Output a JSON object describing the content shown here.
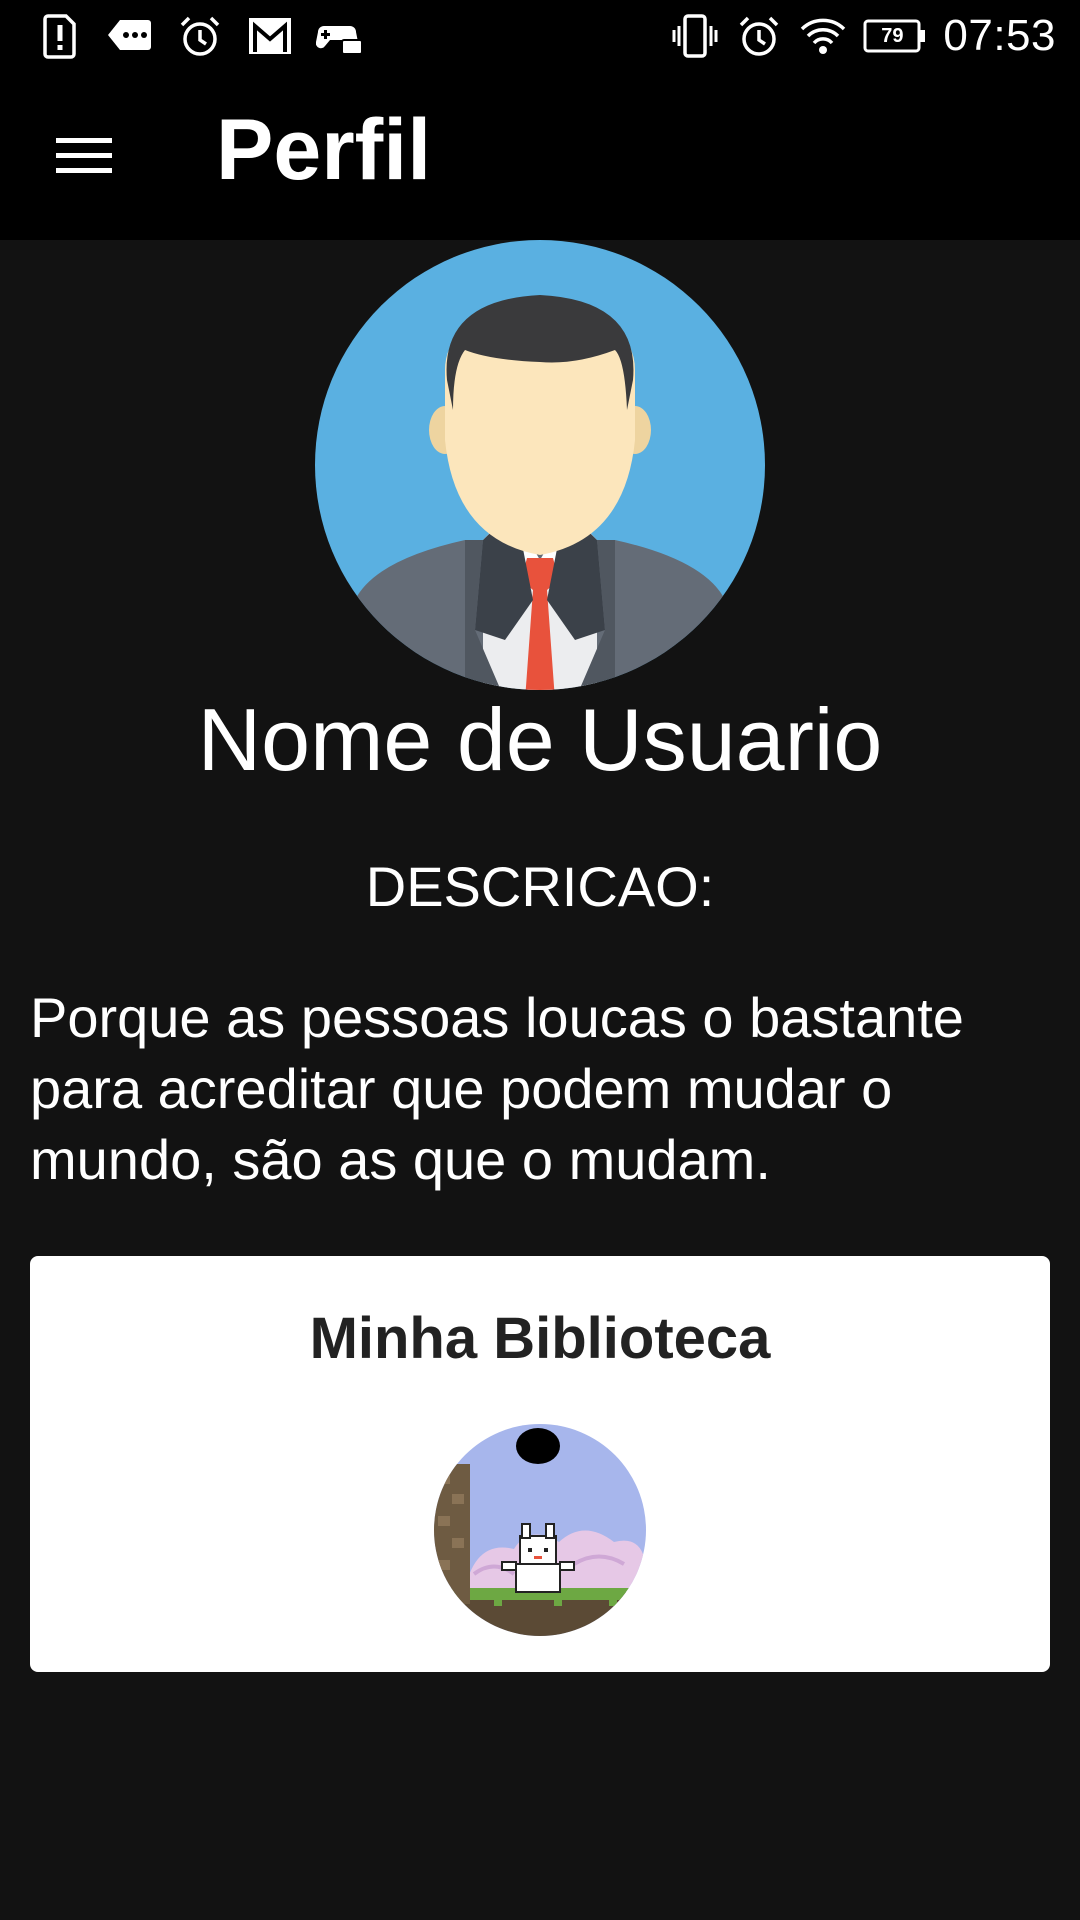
{
  "status_bar": {
    "time": "07:53",
    "battery_level": "79",
    "left_icons": [
      "alert-icon",
      "message-icon",
      "alarm-icon",
      "gmail-icon",
      "game-controller-icon"
    ],
    "right_icons": [
      "vibrate-icon",
      "alarm-icon",
      "wifi-icon",
      "battery-icon"
    ]
  },
  "app_bar": {
    "title": "Perfil",
    "menu_icon": "hamburger-menu-icon"
  },
  "profile": {
    "avatar": "user-avatar",
    "name": "Nome de Usuario",
    "description_label": "DESCRICAO:",
    "description": "Porque as pessoas loucas o bastante para acreditar que podem mudar o mundo, são as que o mudam."
  },
  "library": {
    "title": "Minha Biblioteca",
    "games": [
      {
        "icon": "pixel-game-thumbnail"
      }
    ]
  },
  "colors": {
    "background": "#121212",
    "bars": "#000000",
    "avatar_bg": "#5AB0E1",
    "card": "#ffffff",
    "tie": "#E8523C"
  }
}
